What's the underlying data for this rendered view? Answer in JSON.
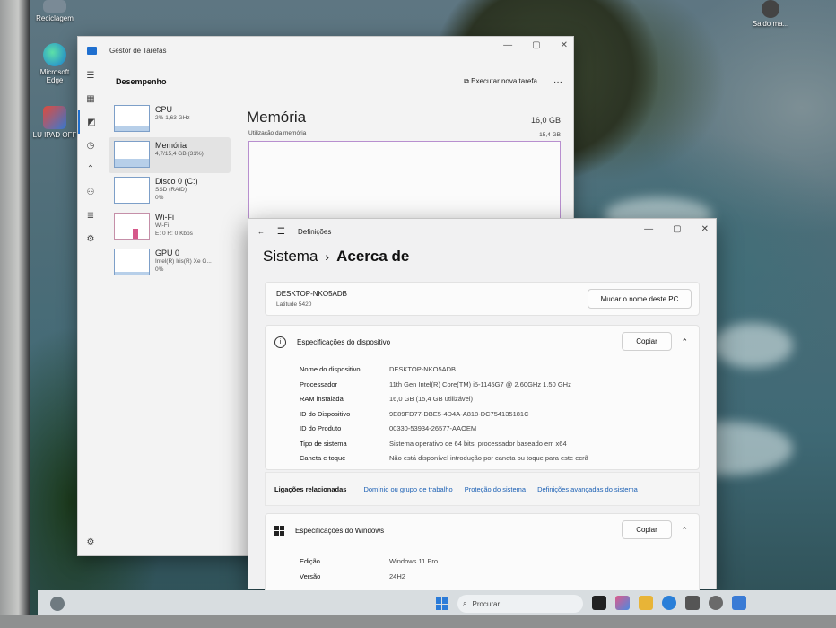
{
  "desktop": {
    "icons": [
      {
        "label": "Reciclagem"
      },
      {
        "label": "Microsoft Edge"
      },
      {
        "label": "LU IPAD OFF"
      }
    ],
    "corner_icon_label": "Saldo ma..."
  },
  "task_manager": {
    "title": "Gestor de Tarefas",
    "section": "Desempenho",
    "run_new_task": "Executar nova tarefa",
    "more": "···",
    "items": [
      {
        "name": "CPU",
        "sub1": "2% 1,63 GHz",
        "sub2": ""
      },
      {
        "name": "Memória",
        "sub1": "4,7/15,4 GB (31%)",
        "sub2": ""
      },
      {
        "name": "Disco 0 (C:)",
        "sub1": "SSD (RAID)",
        "sub2": "0%"
      },
      {
        "name": "Wi-Fi",
        "sub1": "Wi-Fi",
        "sub2": "E: 0 R: 0 Kbps"
      },
      {
        "name": "GPU 0",
        "sub1": "Intel(R) Iris(R) Xe G...",
        "sub2": "0%"
      }
    ],
    "memory": {
      "title": "Memória",
      "total": "16,0 GB",
      "usage_label": "Utilização da memória",
      "usage_value": "15,4 GB",
      "fill_fraction": 0.31
    }
  },
  "settings": {
    "app_title": "Definições",
    "breadcrumb_parent": "Sistema",
    "breadcrumb_sep": "›",
    "breadcrumb_current": "Acerca de",
    "pc_name": "DESKTOP-NKO5ADB",
    "pc_model": "Latitude 5420",
    "rename_button": "Mudar o nome deste PC",
    "device_specs": {
      "header": "Especificações do dispositivo",
      "copy": "Copiar",
      "rows": [
        {
          "k": "Nome do dispositivo",
          "v": "DESKTOP-NKO5ADB"
        },
        {
          "k": "Processador",
          "v": "11th Gen Intel(R) Core(TM) i5-1145G7 @ 2.60GHz   1.50 GHz"
        },
        {
          "k": "RAM instalada",
          "v": "16,0 GB (15,4 GB utilizável)"
        },
        {
          "k": "ID do Dispositivo",
          "v": "9E89FD77-DBE5-4D4A-A818-DC754135181C"
        },
        {
          "k": "ID do Produto",
          "v": "00330-53934-26577-AAOEM"
        },
        {
          "k": "Tipo de sistema",
          "v": "Sistema operativo de 64 bits, processador baseado em x64"
        },
        {
          "k": "Caneta e toque",
          "v": "Não está disponível introdução por caneta ou toque para este ecrã"
        }
      ]
    },
    "related": {
      "label": "Ligações relacionadas",
      "links": [
        "Domínio ou grupo de trabalho",
        "Proteção do sistema",
        "Definições avançadas do sistema"
      ]
    },
    "windows_specs": {
      "header": "Especificações do Windows",
      "copy": "Copiar",
      "rows": [
        {
          "k": "Edição",
          "v": "Windows 11 Pro"
        },
        {
          "k": "Versão",
          "v": "24H2"
        }
      ]
    }
  },
  "taskbar": {
    "search_placeholder": "Procurar"
  }
}
